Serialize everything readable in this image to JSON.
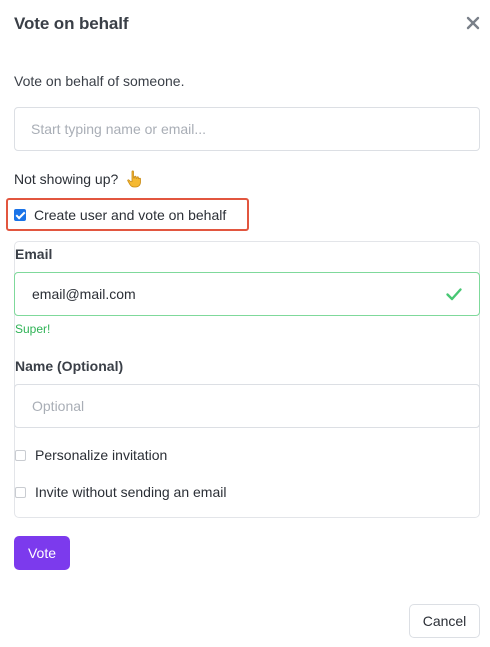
{
  "dialog": {
    "title": "Vote on behalf",
    "close_icon": "close-icon",
    "subtitle": "Vote on behalf of someone."
  },
  "search": {
    "value": "",
    "placeholder": "Start typing name or email..."
  },
  "not_showing": {
    "text": "Not showing up?",
    "icon": "pointing-down-hand-icon"
  },
  "create_user": {
    "label": "Create user and vote on behalf",
    "checked": true,
    "highlight_color": "#e2563f"
  },
  "form": {
    "email": {
      "label": "Email",
      "value": "email@mail.com",
      "status_icon": "check-icon",
      "validation_message": "Super!",
      "valid_color": "#2fb356"
    },
    "name": {
      "label": "Name (Optional)",
      "value": "",
      "placeholder": "Optional"
    },
    "options": [
      {
        "label": "Personalize invitation",
        "checked": false
      },
      {
        "label": "Invite without sending an email",
        "checked": false
      }
    ]
  },
  "actions": {
    "vote_label": "Vote",
    "vote_color": "#7c3aed",
    "cancel_label": "Cancel"
  }
}
